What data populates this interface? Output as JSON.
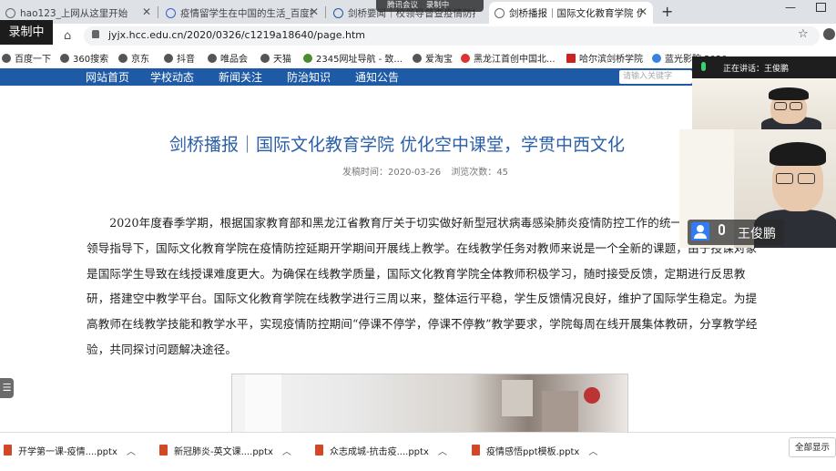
{
  "recording_badge": "录制中",
  "meeting_bar": {
    "label1": "腾讯会议",
    "label2": "录制中"
  },
  "tabs": [
    {
      "title": "hao123_上网从这里开始",
      "active": false
    },
    {
      "title": "疫情留学生在中国的生活_百度搜",
      "active": false
    },
    {
      "title": "剑桥要闻｜校领导督查疫情防控",
      "active": false
    },
    {
      "title": "剑桥播报｜国际文化教育学院 优化",
      "active": true
    }
  ],
  "new_tab_symbol": "+",
  "address": {
    "url": "jyjx.hcc.edu.cn/2020/0326/c1219a18640/page.htm"
  },
  "bookmarks": [
    "百度一下",
    "360搜索",
    "京东",
    "抖音",
    "唯品会",
    "天猫",
    "2345网址导航 - 致...",
    "爱淘宝",
    "黑龙江首创中国北...",
    "哈尔滨剑桥学院",
    "蓝光影院 2020..."
  ],
  "site_nav": {
    "items": [
      "网站首页",
      "学校动态",
      "新闻关注",
      "防治知识",
      "通知公告"
    ],
    "search_placeholder": "请输入关键字"
  },
  "article": {
    "title": "剑桥播报｜国际文化教育学院 优化空中课堂，学贯中西文化",
    "publish_label": "发稿时间：",
    "publish_date": "2020-03-26",
    "views_label": "浏览次数：",
    "views": "45",
    "paragraph": "2020年度春季学期，根据国家教育部和黑龙江省教育厅关于切实做好新型冠状病毒感染肺炎疫情防控工作的统一部署和分管校领导指导下，国际文化教育学院在疫情防控延期开学期间开展线上教学。在线教学任务对教师来说是一个全新的课题，由于授课对象是国际学生导致在线授课难度更大。为确保在线教学质量，国际文化教育学院全体教师积极学习，随时接受反馈，定期进行反思教研，搭建空中教学平台。国际文化教育学院在线教学进行三周以来，整体运行平稳，学生反馈情况良好，维护了国际学生稳定。为提高教师在线教学技能和教学水平，实现疫情防控期间“停课不停学，停课不停教”教学要求，学院每周在线开展集体教研，分享教学经验，共同探讨问题解决途径。"
  },
  "video_panel": {
    "speaking_label": "正在讲话：王俊鹏",
    "participant_name": "王俊鹏"
  },
  "downloads": {
    "files": [
      "开学第一课-疫情....pptx",
      "新冠肺炎-英文课....pptx",
      "众志成城-抗击疫....pptx",
      "疫情感悟ppt模板.pptx"
    ],
    "show_all": "全部显示"
  },
  "side_button": "☰"
}
